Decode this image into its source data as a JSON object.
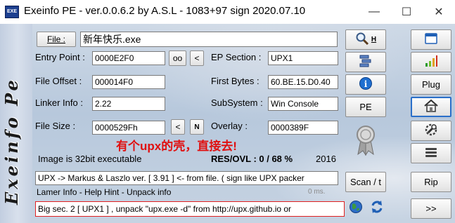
{
  "window": {
    "title": "Exeinfo PE - ver.0.0.6.2  by A.S.L -  1083+97 sign  2020.07.10",
    "icon_text": "EXE",
    "minimize_glyph": "—",
    "maximize_glyph": "☐",
    "close_glyph": "✕"
  },
  "sidebar": {
    "text": "Exeinfo  Pe"
  },
  "file": {
    "button_label": "File :",
    "value": "新年快乐.exe"
  },
  "fields": {
    "entry_point": {
      "label": "Entry Point :",
      "value": "0000E2F0",
      "btn1": "oo",
      "btn2": "<"
    },
    "ep_section": {
      "label": "EP Section :",
      "value": "UPX1"
    },
    "file_offset": {
      "label": "File Offset :",
      "value": "000014F0"
    },
    "first_bytes": {
      "label": "First Bytes :",
      "value": "60.BE.15.D0.40"
    },
    "linker_info": {
      "label": "Linker Info :",
      "value": "2.22"
    },
    "subsystem": {
      "label": "SubSystem :",
      "value": "Win Console"
    },
    "file_size": {
      "label": "File Size :",
      "value": "0000529Fh",
      "btn1": "<",
      "btn2": "N"
    },
    "overlay": {
      "label": "Overlay :",
      "value": "0000389F"
    }
  },
  "status": {
    "image_type": "Image is 32bit executable",
    "res_ovl": "RES/OVL : 0 / 68 %",
    "year": "2016",
    "annotation": "有个upx的壳，直接去!",
    "detect_line": "UPX -> Markus & Laszlo ver. [ 3.91 ] <- from file. ( sign like UPX packer",
    "lamer_info": "Lamer Info - Help Hint - Unpack info",
    "timing": "0 ms.",
    "hint_line": "Big sec. 2 [ UPX1 ] , unpack \"upx.exe -d\"  from  http://upx.github.io or"
  },
  "middle_buttons": {
    "search_h": "H",
    "pe": "PE",
    "scan": "Scan / t"
  },
  "right_buttons": {
    "plug": "Plug",
    "rip": "Rip",
    "next": ">>"
  },
  "colors": {
    "accent": "#2a6fc9",
    "annotation": "#e01010",
    "hint_border": "#e02020"
  }
}
